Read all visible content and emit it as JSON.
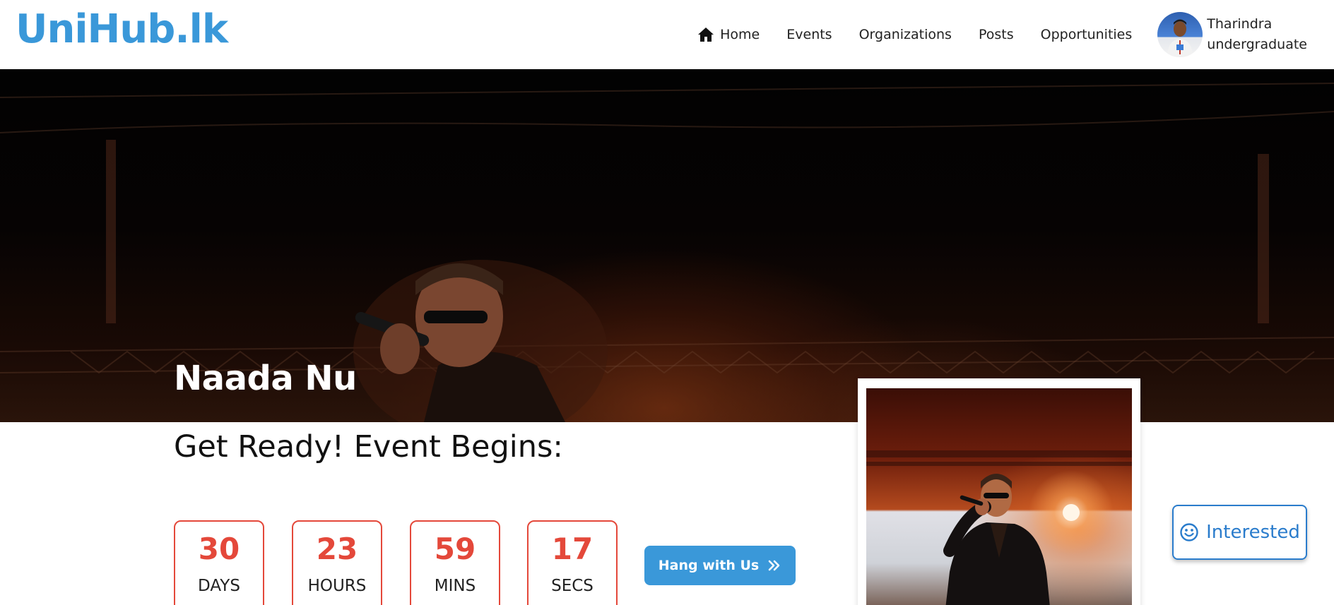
{
  "header": {
    "logo": "UniHub.lk",
    "nav": [
      {
        "label": "Home",
        "icon": "home-icon"
      },
      {
        "label": "Events"
      },
      {
        "label": "Organizations"
      },
      {
        "label": "Posts"
      },
      {
        "label": "Opportunities"
      }
    ],
    "profile": {
      "name": "Tharindra",
      "role": "undergraduate",
      "avatar_icon": "user-avatar"
    }
  },
  "hero": {
    "event_title": "Naada Nu"
  },
  "countdown": {
    "heading": "Get Ready! Event Begins:",
    "units": [
      {
        "value": "30",
        "label": "DAYS"
      },
      {
        "value": "23",
        "label": "HOURS"
      },
      {
        "value": "59",
        "label": "MINS"
      },
      {
        "value": "17",
        "label": "SECS"
      }
    ],
    "action_label": "Hang with Us",
    "action_icon": "double-chevron-right-icon"
  },
  "interested": {
    "label": "Interested",
    "icon": "smile-icon"
  },
  "colors": {
    "brand": "#3a98d9",
    "countdown_accent": "#e4483a",
    "interested_accent": "#2a7ccc"
  }
}
